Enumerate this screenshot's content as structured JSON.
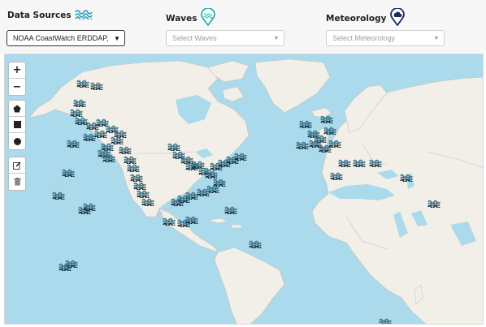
{
  "filters": {
    "data_sources": {
      "label": "Data Sources",
      "icon": "waves-icon",
      "selected": "NOAA CoastWatch ERDDAP, SE"
    },
    "waves": {
      "label": "Waves",
      "icon": "wave-pin-icon",
      "placeholder": "Select Waves"
    },
    "meteorology": {
      "label": "Meteorology",
      "icon": "weather-pin-icon",
      "placeholder": "Select Meteorology"
    }
  },
  "map": {
    "zoom_in_label": "+",
    "zoom_out_label": "−",
    "draw_tools": [
      "draw-polygon",
      "draw-rectangle",
      "draw-circle",
      "edit-layers",
      "delete-layers"
    ],
    "marker_icon": "buoy-waves-icon",
    "colors": {
      "ocean": "#aadaeb",
      "land": "#f2efe9",
      "marker_fill": "#5cc3e6",
      "marker_stroke": "#0d1f2b",
      "waves_pin": "#2bb3a3",
      "meteorology_pin": "#1d2a5c"
    }
  }
}
